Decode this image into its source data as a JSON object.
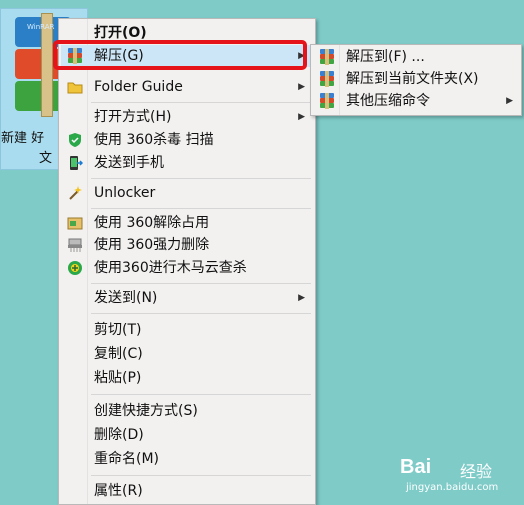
{
  "desktop": {
    "file_label_line1": "新建 好",
    "file_label_line2": "文",
    "icon_tag": "WinRAR"
  },
  "context_menu": {
    "items": [
      {
        "label": "打开(O)",
        "icon": "none",
        "bold": true
      },
      {
        "label": "解压(G)",
        "icon": "winrar-icon",
        "submenu": true,
        "highlighted": true
      },
      {
        "label": "Folder Guide",
        "icon": "folder-icon",
        "submenu": true
      },
      {
        "label": "打开方式(H)",
        "icon": "none",
        "submenu": true
      },
      {
        "label": "使用 360杀毒 扫描",
        "icon": "360-antivirus-icon"
      },
      {
        "label": "发送到手机",
        "icon": "send-to-phone-icon"
      },
      {
        "label": "Unlocker",
        "icon": "wand-icon"
      },
      {
        "label": "使用 360解除占用",
        "icon": "360-unlock-icon"
      },
      {
        "label": "使用 360强力删除",
        "icon": "shredder-icon"
      },
      {
        "label": "使用360进行木马云查杀",
        "icon": "360-trojan-scan-icon"
      },
      {
        "label": "发送到(N)",
        "icon": "none",
        "submenu": true
      },
      {
        "label": "剪切(T)",
        "icon": "none"
      },
      {
        "label": "复制(C)",
        "icon": "none"
      },
      {
        "label": "粘贴(P)",
        "icon": "none"
      },
      {
        "label": "创建快捷方式(S)",
        "icon": "none"
      },
      {
        "label": "删除(D)",
        "icon": "none"
      },
      {
        "label": "重命名(M)",
        "icon": "none"
      },
      {
        "label": "属性(R)",
        "icon": "none"
      }
    ]
  },
  "submenu": {
    "items": [
      {
        "label": "解压到(F) ...",
        "icon": "winrar-icon"
      },
      {
        "label": "解压到当前文件夹(X)",
        "icon": "winrar-icon"
      },
      {
        "label": "其他压缩命令",
        "icon": "winrar-icon",
        "submenu": true
      }
    ]
  },
  "watermark": {
    "brand": "Bai",
    "brand_suffix": "经验",
    "url": "jingyan.baidu.com"
  },
  "colors": {
    "desktop_bg": "#7ecbc8",
    "menu_bg": "#f2f1f0",
    "highlight_box": "#e5141a"
  }
}
